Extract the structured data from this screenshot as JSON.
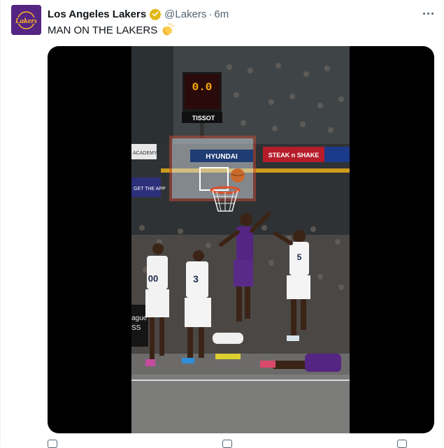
{
  "tweet": {
    "author_name": "Los Angeles Lakers",
    "handle": "@Lakers",
    "separator": "·",
    "time": "6m",
    "text": "MAN ON THE LAKERS",
    "emoji": "clapping-hands",
    "avatar_logo_text": "Lakers"
  },
  "video": {
    "scoreboard_clock": "0.0",
    "scoreboard_brand": "TISSOT",
    "backboard_sponsor": "HYUNDAI",
    "banner_right": "STEAK n SHAKE",
    "banner_left_top": "ACADEMY",
    "banner_left_mid": "GET THE APP",
    "courtside_text": "ague",
    "courtside_text_2": "SS",
    "jersey_numbers": [
      "00",
      "3",
      "5"
    ]
  },
  "colors": {
    "lakers_purple": "#552583",
    "lakers_gold": "#FDB927",
    "verified_gold": "#E2B719",
    "muted_text": "#536471"
  },
  "icons": {
    "more": "more-horizontal-icon",
    "verified": "verified-badge-icon"
  }
}
